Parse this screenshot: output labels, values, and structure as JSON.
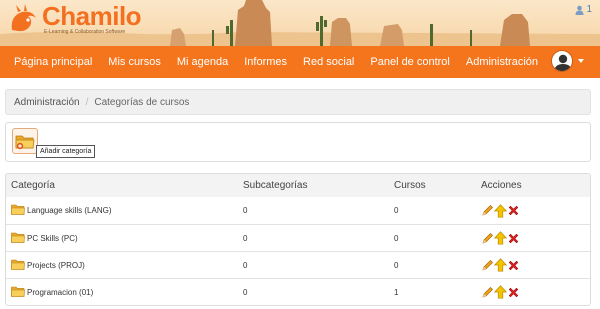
{
  "app": {
    "logo_name": "Chamilo",
    "logo_tagline": "E-Learning & Collaboration Software",
    "online_users": "1"
  },
  "nav": {
    "items": [
      {
        "label": "Página principal"
      },
      {
        "label": "Mis cursos"
      },
      {
        "label": "Mi agenda"
      },
      {
        "label": "Informes"
      },
      {
        "label": "Red social"
      },
      {
        "label": "Panel de control"
      },
      {
        "label": "Administración"
      }
    ]
  },
  "breadcrumb": {
    "root": "Administración",
    "current": "Categorías de cursos"
  },
  "toolbar": {
    "add_tooltip": "Añadir categoría"
  },
  "table": {
    "headers": {
      "category": "Categoría",
      "subcategories": "Subcategorías",
      "courses": "Cursos",
      "actions": "Acciones"
    },
    "rows": [
      {
        "name": "Language skills (LANG)",
        "subcategories": "0",
        "courses": "0"
      },
      {
        "name": "PC Skills (PC)",
        "subcategories": "0",
        "courses": "0"
      },
      {
        "name": "Projects (PROJ)",
        "subcategories": "0",
        "courses": "0"
      },
      {
        "name": "Programacion (01)",
        "subcategories": "0",
        "courses": "1"
      }
    ]
  },
  "colors": {
    "brand": "#f5751c",
    "logo": "#f37021",
    "edit": "#f0a020",
    "move": "#f5c400",
    "delete": "#d42020"
  },
  "icons": {
    "user": "user-icon",
    "folder": "folder-icon",
    "add_category": "folder-add-icon",
    "edit": "pencil-icon",
    "move_up": "arrow-up-icon",
    "delete": "delete-icon"
  }
}
